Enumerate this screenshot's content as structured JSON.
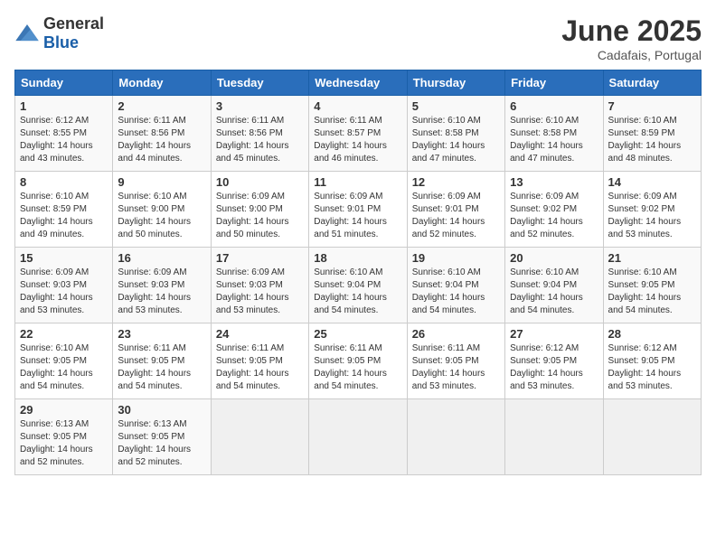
{
  "header": {
    "logo_general": "General",
    "logo_blue": "Blue",
    "month": "June 2025",
    "location": "Cadafais, Portugal"
  },
  "weekdays": [
    "Sunday",
    "Monday",
    "Tuesday",
    "Wednesday",
    "Thursday",
    "Friday",
    "Saturday"
  ],
  "weeks": [
    [
      {
        "day": "1",
        "sunrise": "6:12 AM",
        "sunset": "8:55 PM",
        "daylight": "14 hours and 43 minutes."
      },
      {
        "day": "2",
        "sunrise": "6:11 AM",
        "sunset": "8:56 PM",
        "daylight": "14 hours and 44 minutes."
      },
      {
        "day": "3",
        "sunrise": "6:11 AM",
        "sunset": "8:56 PM",
        "daylight": "14 hours and 45 minutes."
      },
      {
        "day": "4",
        "sunrise": "6:11 AM",
        "sunset": "8:57 PM",
        "daylight": "14 hours and 46 minutes."
      },
      {
        "day": "5",
        "sunrise": "6:10 AM",
        "sunset": "8:58 PM",
        "daylight": "14 hours and 47 minutes."
      },
      {
        "day": "6",
        "sunrise": "6:10 AM",
        "sunset": "8:58 PM",
        "daylight": "14 hours and 47 minutes."
      },
      {
        "day": "7",
        "sunrise": "6:10 AM",
        "sunset": "8:59 PM",
        "daylight": "14 hours and 48 minutes."
      }
    ],
    [
      {
        "day": "8",
        "sunrise": "6:10 AM",
        "sunset": "8:59 PM",
        "daylight": "14 hours and 49 minutes."
      },
      {
        "day": "9",
        "sunrise": "6:10 AM",
        "sunset": "9:00 PM",
        "daylight": "14 hours and 50 minutes."
      },
      {
        "day": "10",
        "sunrise": "6:09 AM",
        "sunset": "9:00 PM",
        "daylight": "14 hours and 50 minutes."
      },
      {
        "day": "11",
        "sunrise": "6:09 AM",
        "sunset": "9:01 PM",
        "daylight": "14 hours and 51 minutes."
      },
      {
        "day": "12",
        "sunrise": "6:09 AM",
        "sunset": "9:01 PM",
        "daylight": "14 hours and 52 minutes."
      },
      {
        "day": "13",
        "sunrise": "6:09 AM",
        "sunset": "9:02 PM",
        "daylight": "14 hours and 52 minutes."
      },
      {
        "day": "14",
        "sunrise": "6:09 AM",
        "sunset": "9:02 PM",
        "daylight": "14 hours and 53 minutes."
      }
    ],
    [
      {
        "day": "15",
        "sunrise": "6:09 AM",
        "sunset": "9:03 PM",
        "daylight": "14 hours and 53 minutes."
      },
      {
        "day": "16",
        "sunrise": "6:09 AM",
        "sunset": "9:03 PM",
        "daylight": "14 hours and 53 minutes."
      },
      {
        "day": "17",
        "sunrise": "6:09 AM",
        "sunset": "9:03 PM",
        "daylight": "14 hours and 53 minutes."
      },
      {
        "day": "18",
        "sunrise": "6:10 AM",
        "sunset": "9:04 PM",
        "daylight": "14 hours and 54 minutes."
      },
      {
        "day": "19",
        "sunrise": "6:10 AM",
        "sunset": "9:04 PM",
        "daylight": "14 hours and 54 minutes."
      },
      {
        "day": "20",
        "sunrise": "6:10 AM",
        "sunset": "9:04 PM",
        "daylight": "14 hours and 54 minutes."
      },
      {
        "day": "21",
        "sunrise": "6:10 AM",
        "sunset": "9:05 PM",
        "daylight": "14 hours and 54 minutes."
      }
    ],
    [
      {
        "day": "22",
        "sunrise": "6:10 AM",
        "sunset": "9:05 PM",
        "daylight": "14 hours and 54 minutes."
      },
      {
        "day": "23",
        "sunrise": "6:11 AM",
        "sunset": "9:05 PM",
        "daylight": "14 hours and 54 minutes."
      },
      {
        "day": "24",
        "sunrise": "6:11 AM",
        "sunset": "9:05 PM",
        "daylight": "14 hours and 54 minutes."
      },
      {
        "day": "25",
        "sunrise": "6:11 AM",
        "sunset": "9:05 PM",
        "daylight": "14 hours and 54 minutes."
      },
      {
        "day": "26",
        "sunrise": "6:11 AM",
        "sunset": "9:05 PM",
        "daylight": "14 hours and 53 minutes."
      },
      {
        "day": "27",
        "sunrise": "6:12 AM",
        "sunset": "9:05 PM",
        "daylight": "14 hours and 53 minutes."
      },
      {
        "day": "28",
        "sunrise": "6:12 AM",
        "sunset": "9:05 PM",
        "daylight": "14 hours and 53 minutes."
      }
    ],
    [
      {
        "day": "29",
        "sunrise": "6:13 AM",
        "sunset": "9:05 PM",
        "daylight": "14 hours and 52 minutes."
      },
      {
        "day": "30",
        "sunrise": "6:13 AM",
        "sunset": "9:05 PM",
        "daylight": "14 hours and 52 minutes."
      },
      null,
      null,
      null,
      null,
      null
    ]
  ]
}
